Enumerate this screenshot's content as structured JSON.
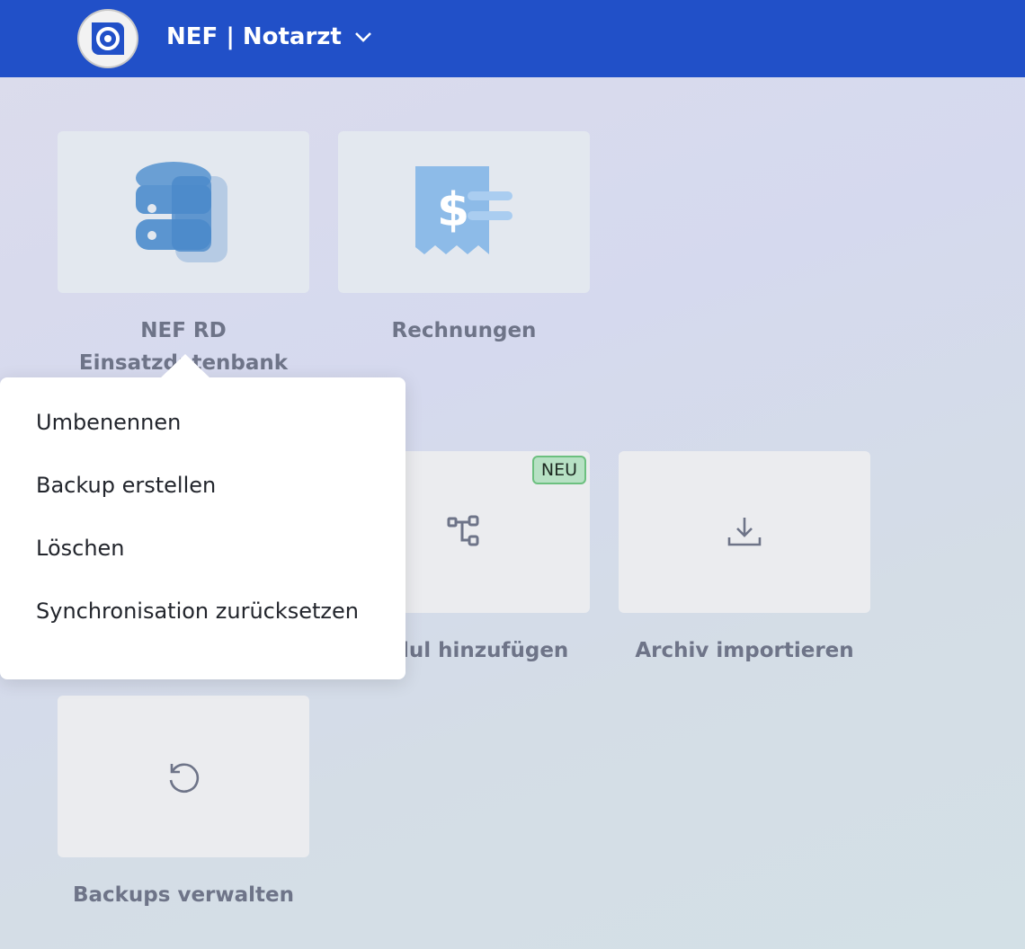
{
  "header": {
    "title": "NEF | Notarzt"
  },
  "tiles": [
    {
      "label": "NEF RD Einsatzdatenbank"
    },
    {
      "label": "Rechnungen"
    },
    {
      "label": "Modul hinzufügen",
      "badge": "NEU"
    },
    {
      "label": "Archiv importieren"
    },
    {
      "label": "Backups verwalten"
    }
  ],
  "context_menu": {
    "items": [
      "Umbenennen",
      "Backup erstellen",
      "Löschen",
      "Synchronisation zurücksetzen"
    ]
  },
  "colors": {
    "header": "#2150c8",
    "badge": "#b7e1c4"
  }
}
